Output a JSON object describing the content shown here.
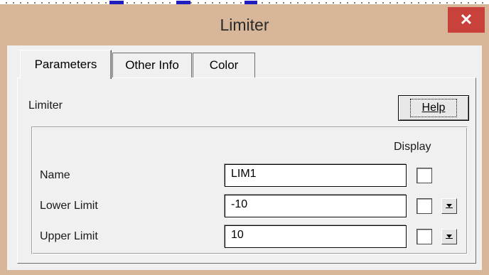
{
  "window": {
    "title": "Limiter"
  },
  "tabs": [
    {
      "label": "Parameters",
      "active": true
    },
    {
      "label": "Other Info",
      "active": false
    },
    {
      "label": "Color",
      "active": false
    }
  ],
  "panel": {
    "heading": "Limiter",
    "help_label": "Help",
    "display_header": "Display",
    "rows": [
      {
        "label": "Name",
        "value": "LIM1",
        "display_checked": false,
        "has_dropdown": false
      },
      {
        "label": "Lower Limit",
        "value": "-10",
        "display_checked": false,
        "has_dropdown": true
      },
      {
        "label": "Upper Limit",
        "value": "10",
        "display_checked": false,
        "has_dropdown": true
      }
    ]
  },
  "icons": {
    "close": "close-icon",
    "dropdown": "chevron-down-icon"
  },
  "colors": {
    "window_bg": "#d8b699",
    "close_button": "#c8413b",
    "client_bg": "#f0f0f0"
  }
}
